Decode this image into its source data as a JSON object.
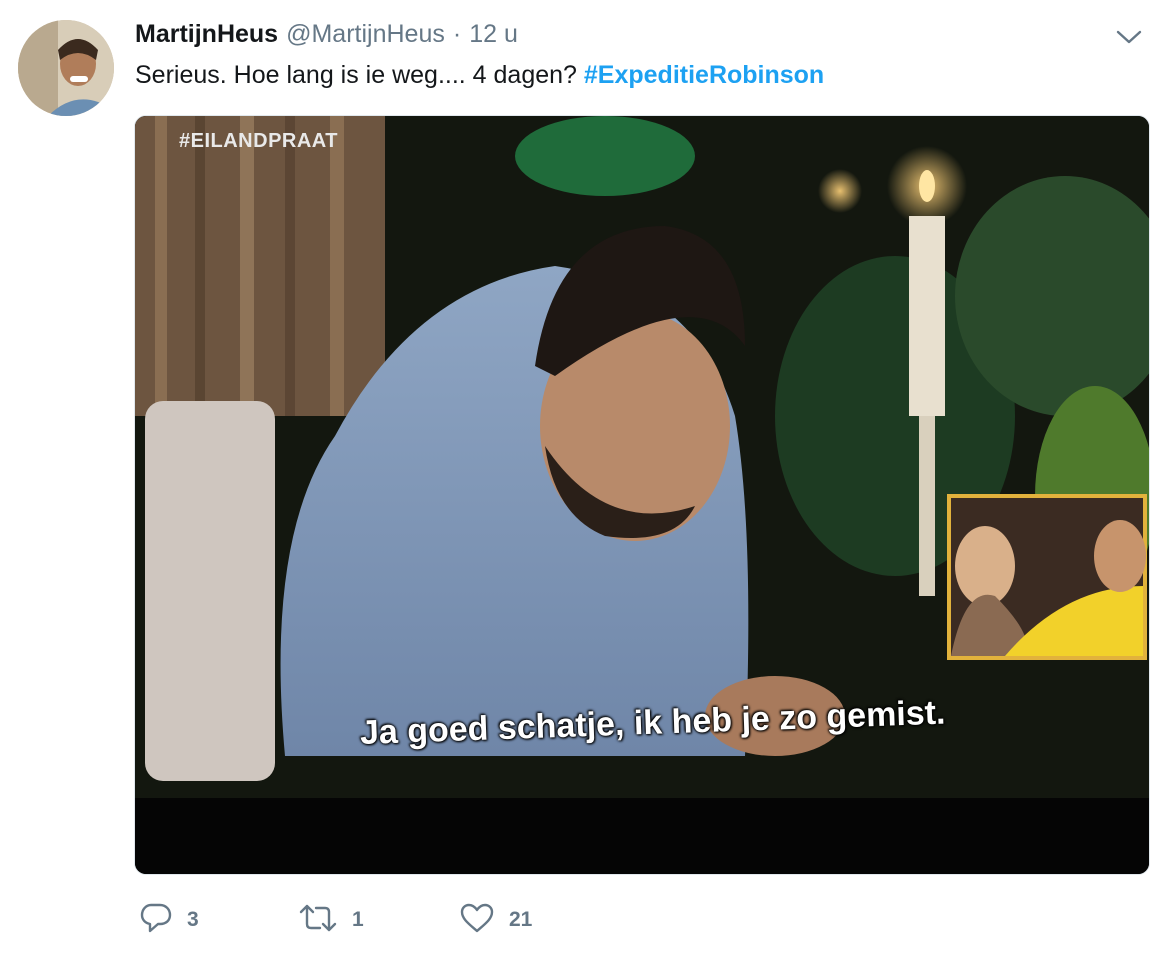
{
  "tweet": {
    "display_name": "MartijnHeus",
    "handle": "@MartijnHeus",
    "separator": "·",
    "time": "12 u",
    "text": "Serieus. Hoe lang is ie weg.... 4 dagen? ",
    "hashtag": "#ExpeditieRobinson"
  },
  "media": {
    "overlay_tag": "#EILANDPRAAT",
    "subtitle": "Ja goed schatje, ik heb je zo gemist."
  },
  "actions": {
    "reply_count": "3",
    "retweet_count": "1",
    "like_count": "21"
  },
  "icons": {
    "caret": "chevron-down-icon",
    "reply": "reply-icon",
    "retweet": "retweet-icon",
    "like": "heart-icon"
  },
  "colors": {
    "hashtag": "#1da1f2",
    "secondary_text": "#657786"
  }
}
